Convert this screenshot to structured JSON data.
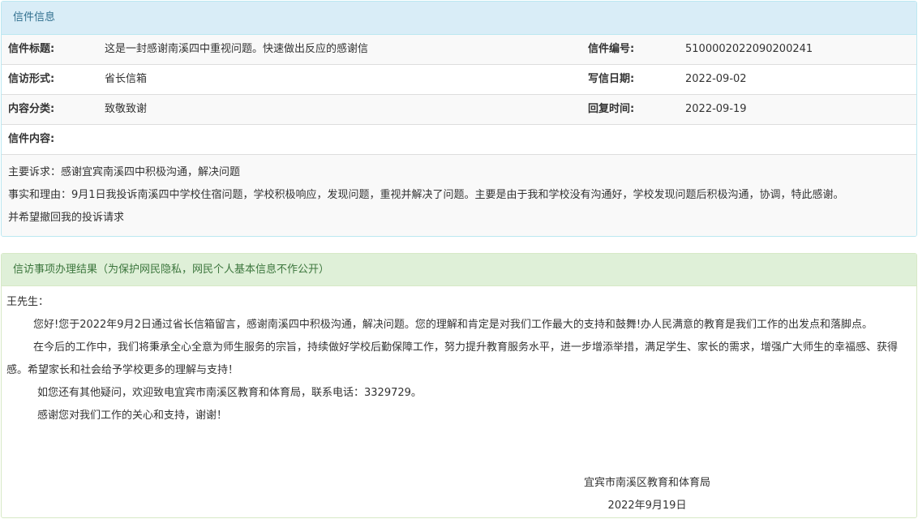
{
  "letter_panel": {
    "title": "信件信息",
    "rows": [
      {
        "label1": "信件标题:",
        "value1": "这是一封感谢南溪四中重视问题。快速做出反应的感谢信",
        "label2": "信件编号:",
        "value2": "5100002022090200241"
      },
      {
        "label1": "信访形式:",
        "value1": "省长信箱",
        "label2": "写信日期:",
        "value2": "2022-09-02"
      },
      {
        "label1": "内容分类:",
        "value1": "致敬致谢",
        "label2": "回复时间:",
        "value2": "2022-09-19"
      }
    ],
    "content_label": "信件内容:",
    "content_lines": [
      "主要诉求：感谢宜宾南溪四中积极沟通，解决问题",
      "事实和理由：9月1日我投诉南溪四中学校住宿问题，学校积极响应，发现问题，重视并解决了问题。主要是由于我和学校没有沟通好，学校发现问题后积极沟通，协调，特此感谢。",
      "并希望撤回我的投诉请求"
    ]
  },
  "reply_panel": {
    "title": "信访事项办理结果（为保护网民隐私，网民个人基本信息不作公开）",
    "salutation": "王先生：",
    "paragraphs": [
      "您好!您于2022年9月2日通过省长信箱留言，感谢南溪四中积极沟通，解决问题。您的理解和肯定是对我们工作最大的支持和鼓舞!办人民满意的教育是我们工作的出发点和落脚点。",
      "在今后的工作中，我们将秉承全心全意为师生服务的宗旨，持续做好学校后勤保障工作，努力提升教育服务水平，进一步增添举措，满足学生、家长的需求，增强广大师生的幸福感、获得感。希望家长和社会给予学校更多的理解与支持！",
      "如您还有其他疑问，欢迎致电宜宾市南溪区教育和体育局，联系电话：3329729。",
      "感谢您对我们工作的关心和支持，谢谢！"
    ],
    "signature_org": "宜宾市南溪区教育和体育局",
    "signature_date": "2022年9月19日"
  }
}
